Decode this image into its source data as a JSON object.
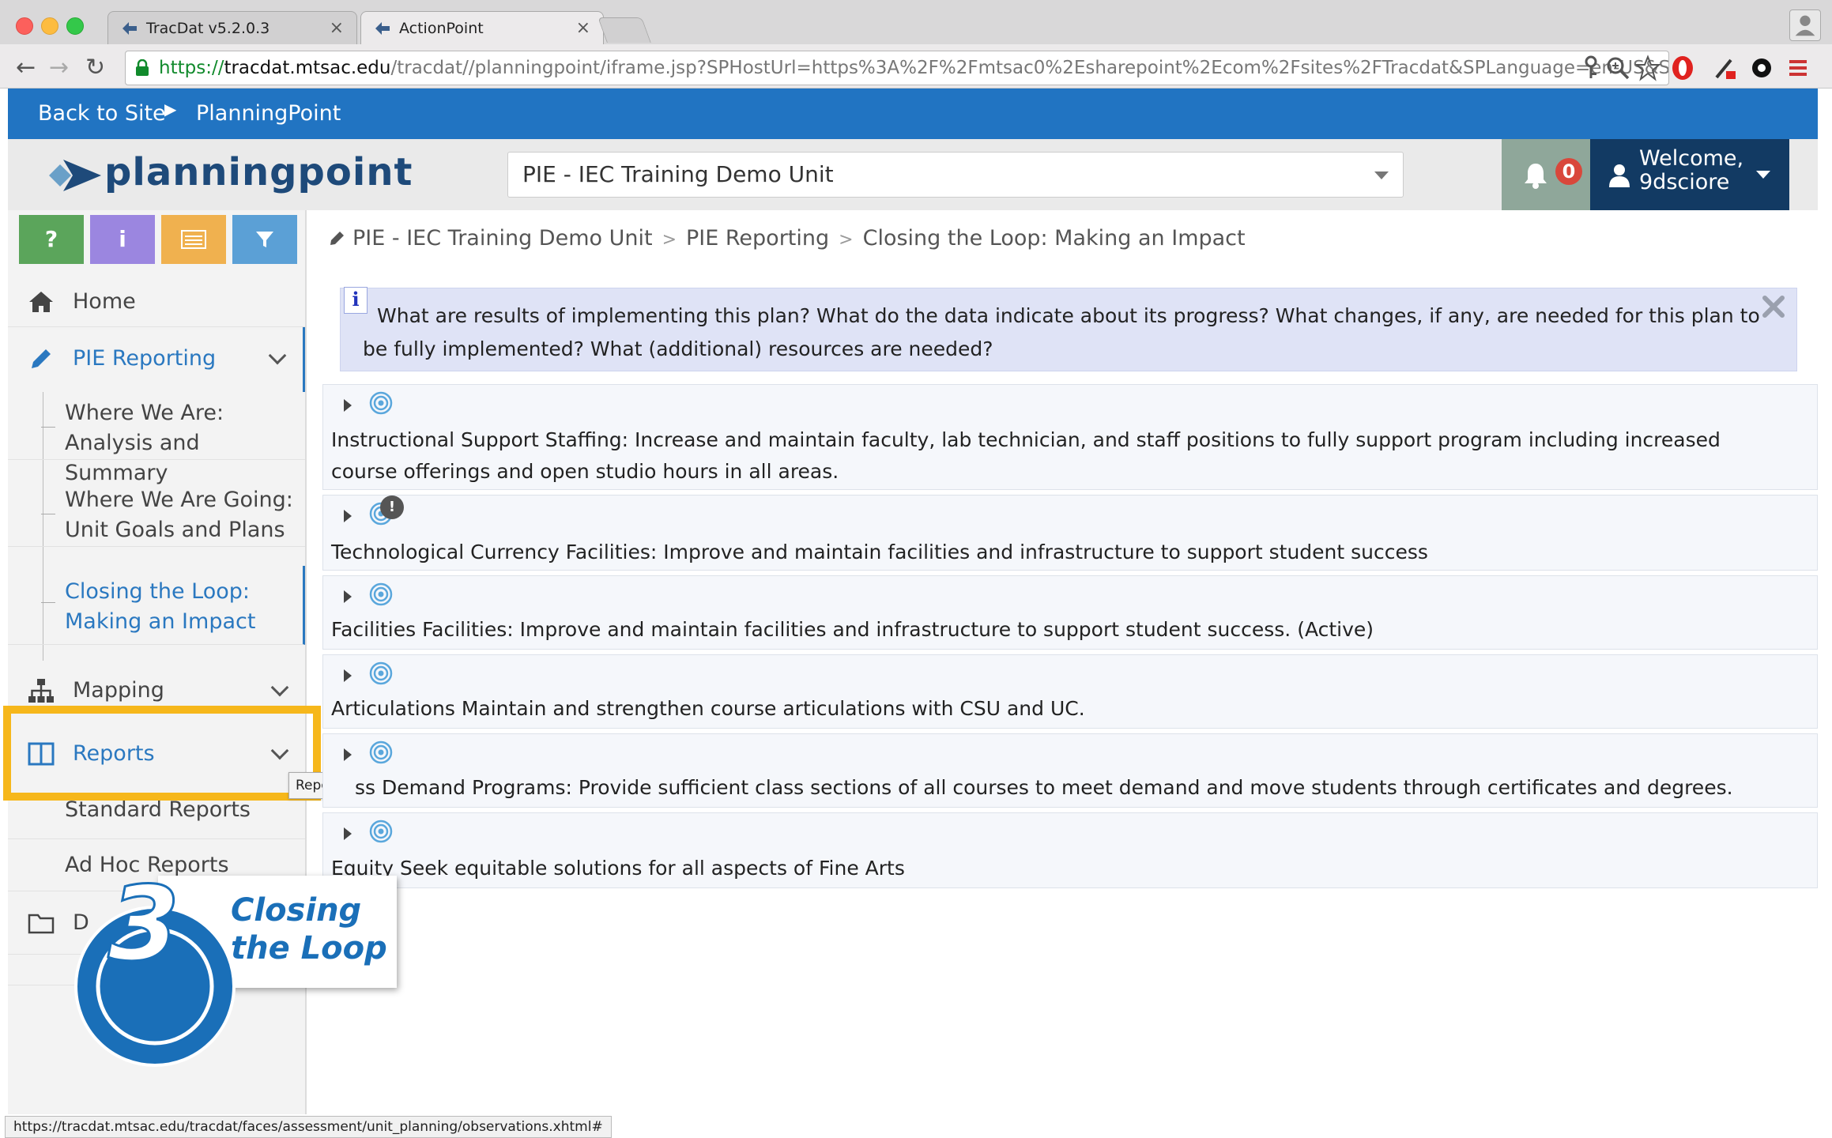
{
  "browser": {
    "tabs": [
      {
        "title": "TracDat v5.2.0.3",
        "close": "×"
      },
      {
        "title": "ActionPoint",
        "close": "×"
      }
    ],
    "url": {
      "scheme": "https://",
      "domain": "tracdat.mtsac.edu",
      "path": "/tracdat//planningpoint/iframe.jsp?SPHostUrl=https%3A%2F%2Fmtsac0%2Esharepoint%2Ecom%2Fsites%2FTracdat&SPLanguage=en-US&SPCli..."
    },
    "status_url": "https://tracdat.mtsac.edu/tracdat/faces/assessment/unit_planning/observations.xhtml#"
  },
  "topbar": {
    "back_label": "Back to Site",
    "current": "PlanningPoint"
  },
  "header": {
    "logo_text": "planningpoint",
    "unit_selected": "PIE - IEC Training Demo Unit",
    "notifications_count": "0",
    "welcome_line1": "Welcome,",
    "welcome_line2": "9dsciore"
  },
  "sidebar": {
    "quick_buttons": [
      {
        "label": "?",
        "color": "#5ba55b"
      },
      {
        "label": "i",
        "color": "#9b86e0"
      },
      {
        "label": "≡",
        "color": "#f0b14f"
      },
      {
        "label": "▼",
        "color": "#5ba0d6"
      }
    ],
    "home": "Home",
    "pie_reporting": "PIE Reporting",
    "pie_sub": [
      "Where We Are: Analysis and Summary",
      "Where We Are Going: Unit Goals and Plans",
      "Closing the Loop: Making an Impact"
    ],
    "mapping": "Mapping",
    "reports": "Reports",
    "reports_sub": [
      "Standard Reports",
      "Ad Hoc Reports"
    ],
    "documents_partial": "D",
    "tooltip": "Reports"
  },
  "breadcrumb": [
    "PIE - IEC Training Demo Unit",
    "PIE Reporting",
    "Closing the Loop: Making an Impact"
  ],
  "info": {
    "icon": "i",
    "text": "What are results of implementing this plan? What do the data indicate about its progress? What changes, if any, are needed for this plan to be fully implemented? What (additional) resources are needed?"
  },
  "plans": [
    {
      "text": "Instructional Support Staffing: Increase and maintain faculty, lab technician, and staff positions to fully support program including increased course offerings and open studio hours in all areas.",
      "badge": ""
    },
    {
      "text": "Technological Currency Facilities: Improve and maintain facilities and infrastructure to support student success",
      "badge": "!"
    },
    {
      "text": "Facilities Facilities: Improve and maintain facilities and infrastructure to support student success. (Active)",
      "badge": ""
    },
    {
      "text": "Articulations Maintain and strengthen course articulations with CSU and UC.",
      "badge": ""
    },
    {
      "text": "ss Demand Programs: Provide sufficient class sections of all courses to meet demand and move students through certificates and degrees.",
      "badge": ""
    },
    {
      "text": "Equity Seek equitable solutions for all aspects of Fine Arts",
      "badge": ""
    }
  ],
  "overlay": {
    "number": "3",
    "line1": "Closing",
    "line2": "the Loop"
  },
  "colors": {
    "accent_blue": "#2174c2",
    "navy": "#123a63",
    "highlight": "#f6b71b",
    "active_link": "#2a78c0"
  }
}
